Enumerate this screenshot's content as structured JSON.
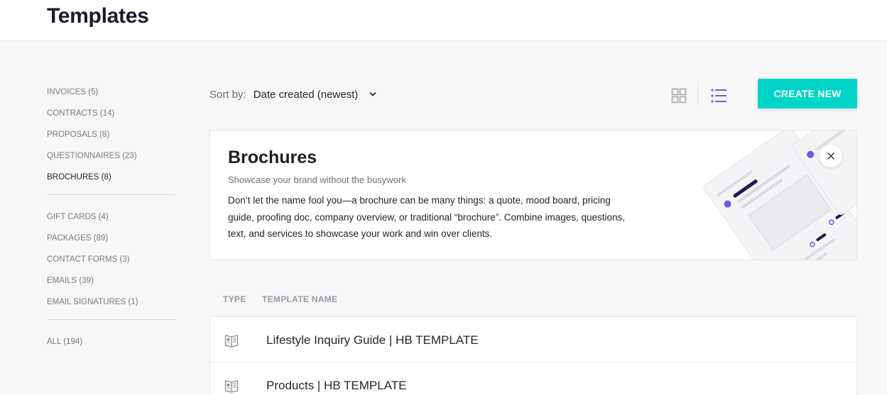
{
  "header": {
    "title": "Templates"
  },
  "sidebar": {
    "group1": [
      {
        "label": "INVOICES (5)",
        "active": false
      },
      {
        "label": "CONTRACTS (14)",
        "active": false
      },
      {
        "label": "PROPOSALS (8)",
        "active": false
      },
      {
        "label": "QUESTIONNAIRES (23)",
        "active": false
      },
      {
        "label": "BROCHURES (8)",
        "active": true
      }
    ],
    "group2": [
      {
        "label": "GIFT CARDS (4)"
      },
      {
        "label": "PACKAGES (89)"
      },
      {
        "label": "CONTACT FORMS (3)"
      },
      {
        "label": "EMAILS (39)"
      },
      {
        "label": "EMAIL SIGNATURES (1)"
      }
    ],
    "group3": [
      {
        "label": "ALL (194)"
      }
    ]
  },
  "toolbar": {
    "sort_label": "Sort by:",
    "sort_value": "Date created (newest)",
    "create_label": "CREATE NEW"
  },
  "banner": {
    "title": "Brochures",
    "subtitle": "Showcase your brand without the busywork",
    "description": "Don’t let the name fool you—a brochure can be many things: a quote, mood board, pricing guide, proofing doc, company overview, or traditional “brochure”. Combine images, questions, text, and services to showcase your work and win over clients."
  },
  "table": {
    "headers": {
      "type": "TYPE",
      "name": "TEMPLATE NAME"
    },
    "rows": [
      {
        "name": "Lifestyle Inquiry Guide | HB TEMPLATE",
        "icon": "brochure-icon"
      },
      {
        "name": "Products | HB TEMPLATE",
        "icon": "brochure-icon"
      }
    ]
  },
  "colors": {
    "accent": "#00d4c9",
    "purple": "#6c5ce7",
    "navy": "#1a1a4e"
  },
  "icons": [
    "chevron-down-icon",
    "grid-view-icon",
    "list-view-icon",
    "close-icon",
    "brochure-icon"
  ]
}
